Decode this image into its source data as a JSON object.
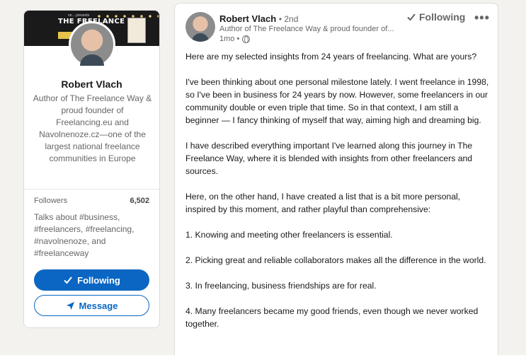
{
  "profile": {
    "name": "Robert Vlach",
    "headline": "Author of The Freelance Way & proud founder of Freelancing.eu and Navolnenoze.cz—one of the largest national freelance communities in Europe",
    "banner": {
      "title": "THE FREELANCE WAY",
      "sub": "ne... presents"
    },
    "followers_label": "Followers",
    "followers_count": "6,502",
    "talks_about": "Talks about #business, #freelancers, #freelancing, #navolnenoze, and #freelanceway",
    "following_button": "Following",
    "message_button": "Message"
  },
  "post": {
    "author": "Robert Vlach",
    "degree": "• 2nd",
    "author_headline": "Author of The Freelance Way & proud founder of...",
    "time": "1mo •",
    "following_label": "Following",
    "more": "•••",
    "paragraphs": [
      "Here are my selected insights from 24 years of freelancing. What are yours?",
      "I've been thinking about one personal milestone lately. I went freelance in 1998, so I've been in business for 24 years by now. However, some freelancers in our community double or even triple that time. So in that context, I am still a beginner — I fancy thinking of myself that way, aiming high and dreaming big.",
      "I have described everything important I've learned along this journey in The Freelance Way, where it is blended with insights from other freelancers and sources.",
      "Here, on the other hand, I have created a list that is a bit more personal, inspired by this moment, and rather playful than comprehensive:",
      "1. Knowing and meeting other freelancers is essential.",
      "2. Picking great and reliable collaborators makes all the difference in the world.",
      "3. In freelancing, business friendships are for real.",
      "4. Many freelancers became my good friends, even though we never worked together."
    ]
  },
  "colors": {
    "accent": "#0a66c2",
    "background": "#f3f2ef"
  }
}
